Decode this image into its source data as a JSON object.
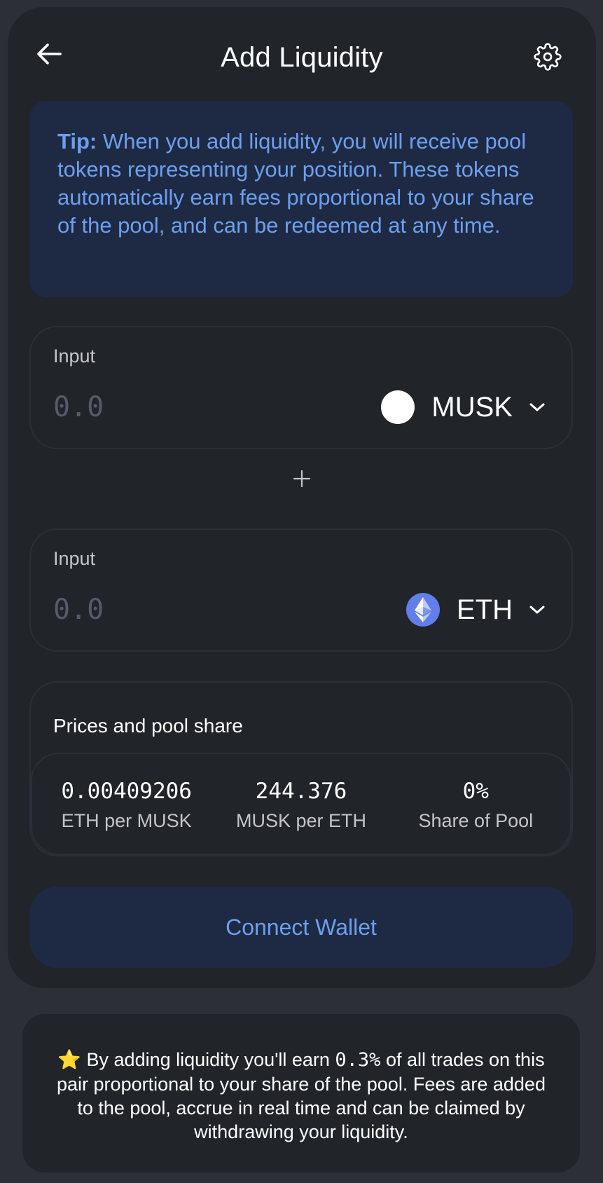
{
  "header": {
    "title": "Add Liquidity",
    "back_icon": "arrow-left-icon",
    "settings_icon": "gear-icon"
  },
  "tip": {
    "label": "Tip:",
    "text": " When you add liquidity, you will receive pool tokens representing your position. These tokens automatically earn fees proportional to your share of the pool, and can be redeemed at any time."
  },
  "inputs": [
    {
      "label": "Input",
      "placeholder": "0.0",
      "value": "",
      "token": "MUSK",
      "token_icon": "white-circle-token-icon"
    },
    {
      "label": "Input",
      "placeholder": "0.0",
      "value": "",
      "token": "ETH",
      "token_icon": "ethereum-icon"
    }
  ],
  "plus_icon": "plus-icon",
  "prices": {
    "title": "Prices and pool share",
    "items": [
      {
        "value": "0.00409206",
        "label": "ETH per MUSK"
      },
      {
        "value": "244.376",
        "label": "MUSK per ETH"
      },
      {
        "value": "0%",
        "label": "Share of Pool"
      }
    ]
  },
  "connect_button": "Connect Wallet",
  "note": {
    "star": "⭐",
    "part1": " By adding liquidity you'll earn ",
    "fee": "0.3%",
    "part2": " of all trades on this pair proportional to your share of the pool. Fees are added to the pool, accrue in real time and can be claimed by withdrawing your liquidity."
  },
  "colors": {
    "background": "#2c2f36",
    "card": "#212429",
    "accent_bg": "#1e2a43",
    "accent_text": "#6d9ff0",
    "eth": "#627eea"
  }
}
